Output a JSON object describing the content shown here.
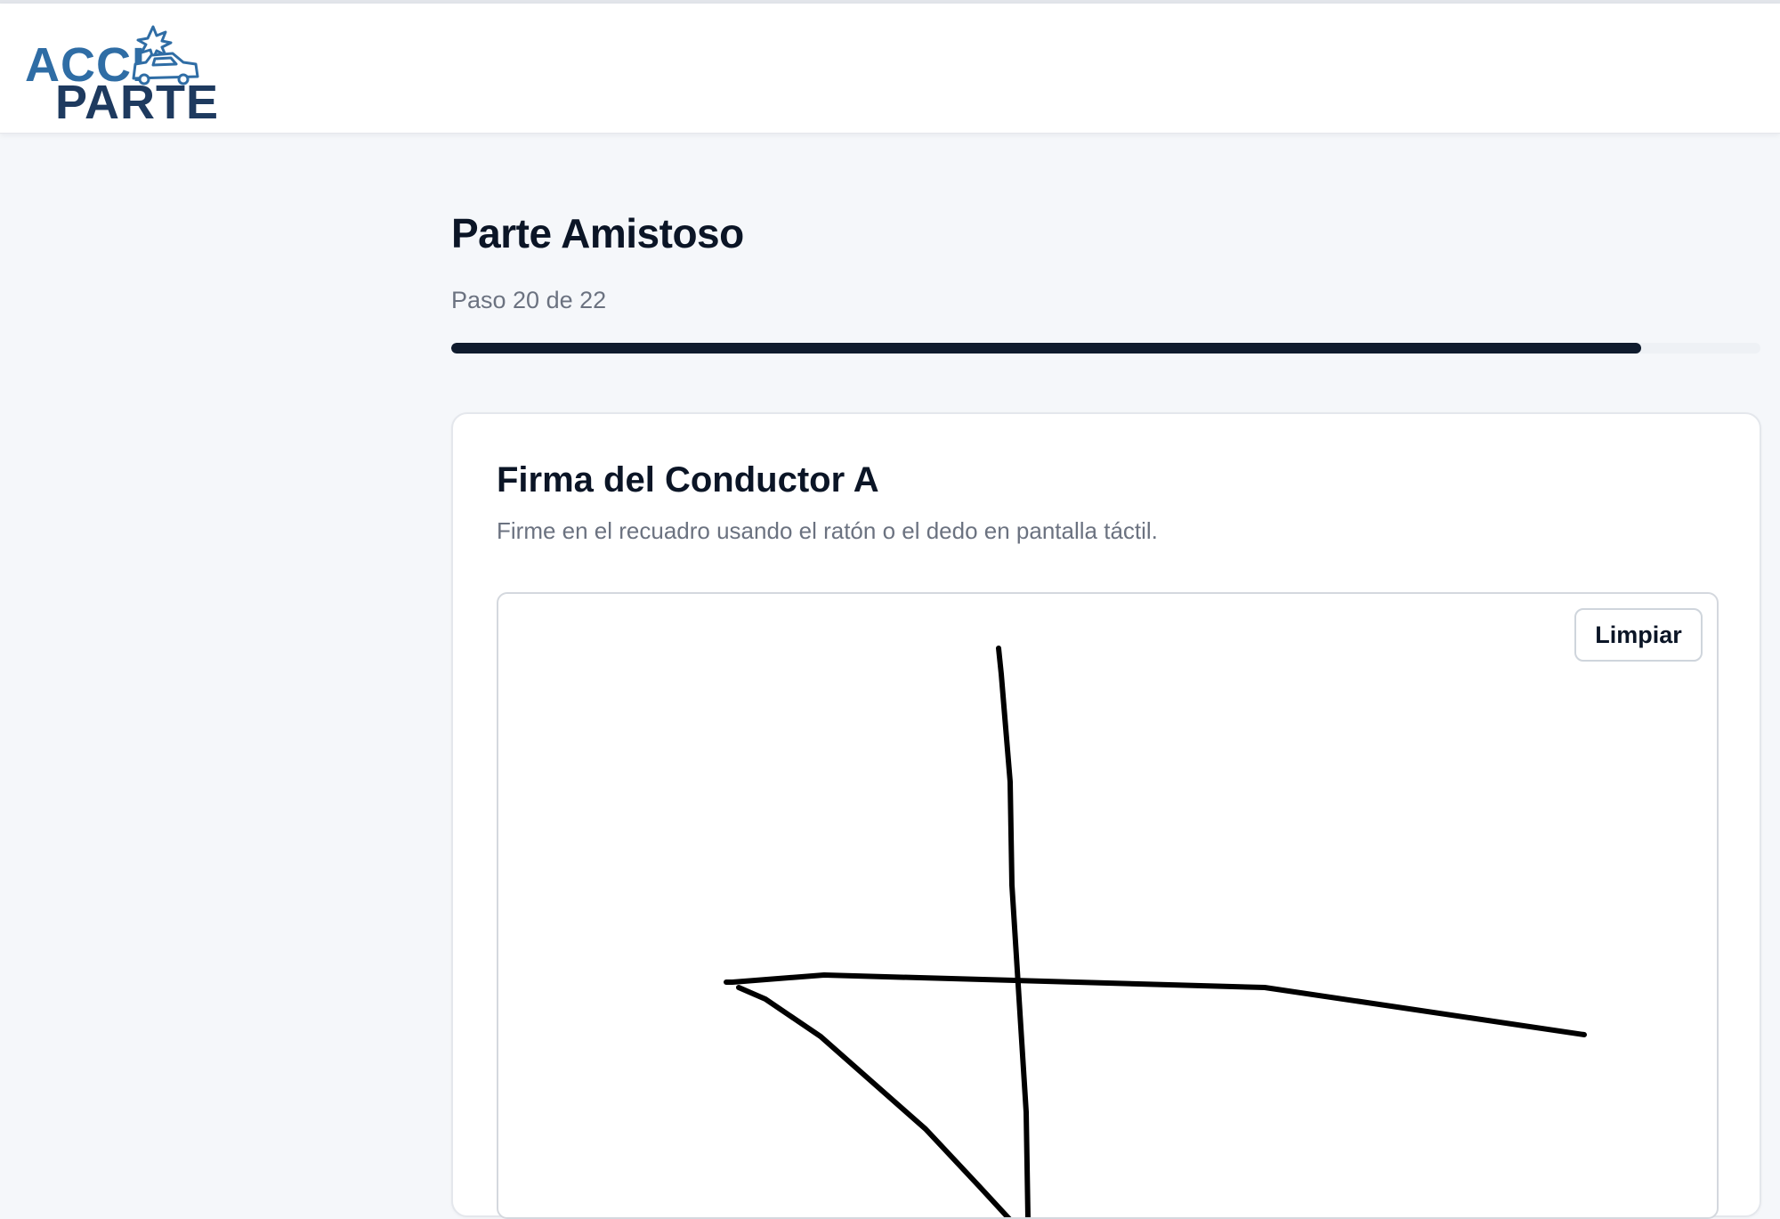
{
  "brand": {
    "logo_line1": "ACCI",
    "logo_line2": "PARTE",
    "logo_icon": "car-crash-icon",
    "colors": {
      "primary": "#2f6da5",
      "dark": "#1e3a5f"
    }
  },
  "page": {
    "title": "Parte Amistoso",
    "step_label": "Paso 20 de 22",
    "progress": {
      "current": 20,
      "total": 22
    }
  },
  "signature_card": {
    "title": "Firma del Conductor A",
    "description": "Firme en el recuadro usando el ratón o el dedo en pantalla táctil.",
    "clear_label": "Limpiar"
  }
}
